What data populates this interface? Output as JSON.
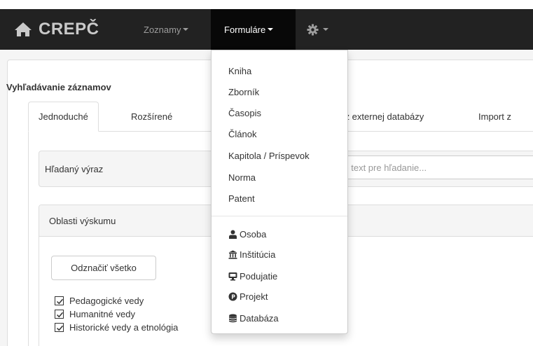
{
  "navbar": {
    "brand": "CREPČ",
    "menu_lists": "Zoznamy",
    "menu_forms": "Formuláre"
  },
  "page": {
    "heading": "Vyhľadávanie záznamov"
  },
  "tabs": [
    {
      "label": "Jednoduché"
    },
    {
      "label": "Rozšírené"
    },
    {
      "label": "rt z externej databázy"
    },
    {
      "label": "Import z"
    }
  ],
  "search": {
    "label": "Hľadaný výraz",
    "placeholder": "ijte text pre hľadanie..."
  },
  "areas": {
    "title": "Oblasti výskumu",
    "deselect_label": "Odznačiť všetko",
    "items": [
      {
        "label": "Pedagogické vedy",
        "checked": true
      },
      {
        "label": "Humanitné vedy",
        "checked": true
      },
      {
        "label": "Historické vedy a etnológia",
        "checked": true
      }
    ]
  },
  "dropdown": {
    "items": [
      {
        "label": "Kniha"
      },
      {
        "label": "Zborník"
      },
      {
        "label": "Časopis"
      },
      {
        "label": "Článok"
      },
      {
        "label": "Kapitola / Príspevok"
      },
      {
        "label": "Norma"
      },
      {
        "label": "Patent"
      }
    ],
    "entity_items": [
      {
        "label": "Osoba",
        "icon": "person-icon"
      },
      {
        "label": "Inštitúcia",
        "icon": "institution-icon"
      },
      {
        "label": "Podujatie",
        "icon": "event-icon"
      },
      {
        "label": "Projekt",
        "icon": "project-icon"
      },
      {
        "label": "Databáza",
        "icon": "database-icon"
      }
    ]
  },
  "colors": {
    "navbar": "#222222",
    "navbar_active": "#080808",
    "accent_text": "#9d9d9d"
  }
}
